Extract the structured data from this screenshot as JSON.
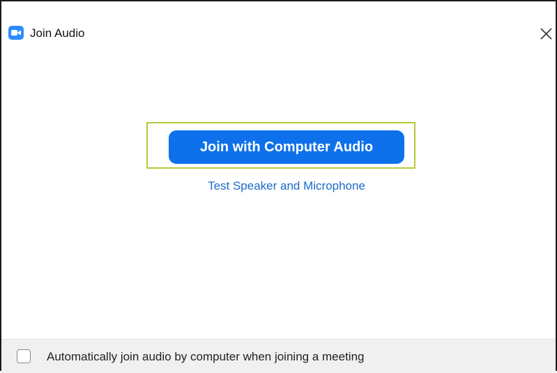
{
  "window": {
    "title": "Join Audio",
    "icon": "zoom-camera-icon",
    "close_icon": "close-icon"
  },
  "main": {
    "join_button_label": "Join with Computer Audio",
    "test_link_label": "Test Speaker and Microphone"
  },
  "footer": {
    "auto_join_label": "Automatically join audio by computer when joining a meeting",
    "auto_join_checked": false
  },
  "colors": {
    "primary": "#0e71eb",
    "link": "#1b6ac9",
    "highlight_border": "#b6c93a",
    "brand_icon": "#2d8cff",
    "footer_bg": "#f0f0f0"
  }
}
